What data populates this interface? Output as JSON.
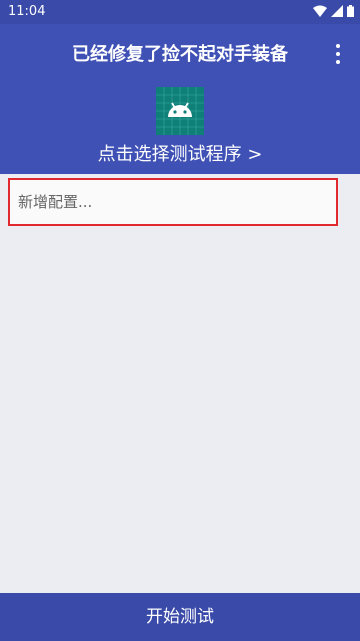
{
  "status": {
    "time": "11:04"
  },
  "header": {
    "title": "已经修复了捡不起对手装备",
    "select_program": "点击选择测试程序 >"
  },
  "config": {
    "placeholder": "新增配置..."
  },
  "footer": {
    "start_label": "开始测试"
  },
  "colors": {
    "primary": "#3f51b5",
    "status": "#3a4aa8",
    "highlight": "#e0282e",
    "icon_bg": "#0f7f78"
  }
}
